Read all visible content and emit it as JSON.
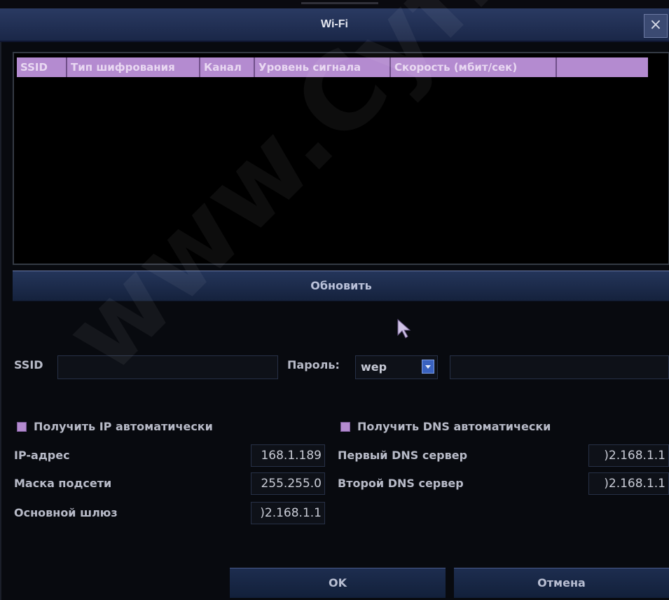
{
  "dialog": {
    "title": "Wi-Fi",
    "close_label": "×"
  },
  "table": {
    "columns": [
      "SSID",
      "Тип шифрования",
      "Канал",
      "Уровень сигнала",
      "Скорость (мбит/сек)",
      ""
    ]
  },
  "refresh_label": "Обновить",
  "wifi": {
    "ssid_label": "SSID",
    "ssid_value": "",
    "password_label": "Пароль:",
    "encryption_selected": "wep",
    "password_value": ""
  },
  "network": {
    "auto_ip_label": "Получить IP автоматически",
    "auto_ip_checked": true,
    "auto_dns_label": "Получить DNS автоматически",
    "auto_dns_checked": true,
    "ip_label": "IP-адрес",
    "ip_value": "168.1.189",
    "mask_label": "Маска подсети",
    "mask_value": "255.255.0",
    "gateway_label": "Основной шлюз",
    "gateway_value": ")2.168.1.1",
    "dns1_label": "Первый DNS сервер",
    "dns1_value": ")2.168.1.1",
    "dns2_label": "Второй DNS сервер",
    "dns2_value": ")2.168.1.1"
  },
  "buttons": {
    "ok_label": "OK",
    "cancel_label": "Отмена"
  },
  "watermark_text": "www.Cyfron.ru",
  "colors": {
    "header_purple": "#b48bd0",
    "title_bar": "#1a2748",
    "background": "#080a0f"
  }
}
